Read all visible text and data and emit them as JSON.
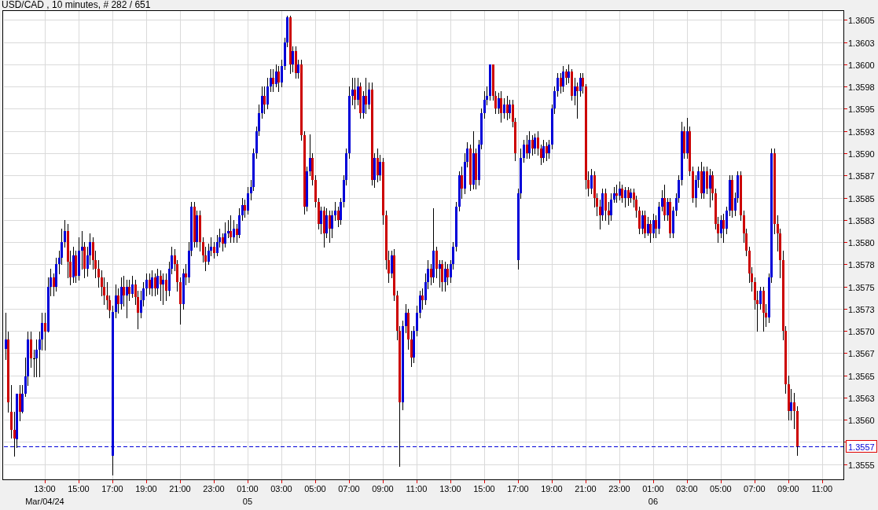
{
  "title": "USD/CAD , 10 minutes, # 282 / 651",
  "chart": {
    "chart_data": {
      "type": "candlestick",
      "grid": true,
      "ylim": [
        1.35532,
        1.36061
      ],
      "ref_lines": [
        {
          "axis": "y",
          "value": 1.3557,
          "label": "1.3557",
          "color": "#0000d8"
        }
      ],
      "categories": [
        null,
        null,
        null,
        null,
        null,
        null,
        null,
        null,
        null,
        null,
        null,
        null,
        null,
        null,
        "13:00\nMar/04/24",
        null,
        null,
        null,
        null,
        null,
        null,
        null,
        null,
        null,
        null,
        null,
        "15:00",
        null,
        null,
        null,
        null,
        null,
        null,
        null,
        null,
        null,
        null,
        null,
        "17:00",
        null,
        null,
        null,
        null,
        null,
        null,
        null,
        null,
        null,
        null,
        null,
        "19:00",
        null,
        null,
        null,
        null,
        null,
        null,
        null,
        null,
        null,
        null,
        null,
        "21:00",
        null,
        null,
        null,
        null,
        null,
        null,
        null,
        null,
        null,
        null,
        null,
        "23:00",
        null,
        null,
        null,
        null,
        null,
        null,
        null,
        null,
        null,
        null,
        null,
        "01:00\n05",
        null,
        null,
        null,
        null,
        null,
        null,
        null,
        null,
        null,
        null,
        null,
        "03:00",
        null,
        null,
        null,
        null,
        null,
        null,
        null,
        null,
        null,
        null,
        null,
        "05:00",
        null,
        null,
        null,
        null,
        null,
        null,
        null,
        null,
        null,
        null,
        null,
        "07:00",
        null,
        null,
        null,
        null,
        null,
        null,
        null,
        null,
        null,
        null,
        null,
        "09:00",
        null,
        null,
        null,
        null,
        null,
        null,
        null,
        null,
        null,
        null,
        null,
        "11:00",
        null,
        null,
        null,
        null,
        null,
        null,
        null,
        null,
        null,
        null,
        null,
        "13:00",
        null,
        null,
        null,
        null,
        null,
        null,
        null,
        null,
        null,
        null,
        null,
        "15:00",
        null,
        null,
        null,
        null,
        null,
        null,
        null,
        null,
        null,
        null,
        null,
        "17:00",
        null,
        null,
        null,
        null,
        null,
        null,
        null,
        null,
        null,
        null,
        null,
        "19:00",
        null,
        null,
        null,
        null,
        null,
        null,
        null,
        null,
        null,
        null,
        null,
        "21:00",
        null,
        null,
        null,
        null,
        null,
        null,
        null,
        null,
        null,
        null,
        null,
        "23:00",
        null,
        null,
        null,
        null,
        null,
        null,
        null,
        null,
        null,
        null,
        null,
        "01:00\n06",
        null,
        null,
        null,
        null,
        null,
        null,
        null,
        null,
        null,
        null,
        null,
        "03:00",
        null,
        null,
        null,
        null,
        null,
        null,
        null,
        null,
        null,
        null,
        null,
        "05:00",
        null,
        null,
        null,
        null,
        null,
        null,
        null,
        null,
        null,
        null,
        null,
        "07:00",
        null,
        null,
        null,
        null,
        null,
        null,
        null,
        null,
        null,
        null,
        null,
        "09:00",
        null,
        null,
        null,
        null,
        null,
        null,
        null,
        null,
        null,
        null,
        null,
        "11:00"
      ],
      "yticks": [
        {
          "value": 1.3605,
          "label": "1.3605"
        },
        {
          "value": 1.36025,
          "label": "1.3603"
        },
        {
          "value": 1.36,
          "label": "1.3600"
        },
        {
          "value": 1.35975,
          "label": "1.3598"
        },
        {
          "value": 1.3595,
          "label": "1.3595"
        },
        {
          "value": 1.35925,
          "label": "1.3593"
        },
        {
          "value": 1.359,
          "label": "1.3590"
        },
        {
          "value": 1.35875,
          "label": "1.3587"
        },
        {
          "value": 1.3585,
          "label": "1.3585"
        },
        {
          "value": 1.35825,
          "label": "1.3583"
        },
        {
          "value": 1.358,
          "label": "1.3580"
        },
        {
          "value": 1.35775,
          "label": "1.3578"
        },
        {
          "value": 1.3575,
          "label": "1.3575"
        },
        {
          "value": 1.35725,
          "label": "1.3573"
        },
        {
          "value": 1.357,
          "label": "1.3570"
        },
        {
          "value": 1.35675,
          "label": "1.3567"
        },
        {
          "value": 1.3565,
          "label": "1.3565"
        },
        {
          "value": 1.35625,
          "label": "1.3563"
        },
        {
          "value": 1.356,
          "label": "1.3560"
        },
        {
          "value": 1.3555,
          "label": "1.3555"
        }
      ],
      "ohlc": [
        [
          1.3568,
          1.3572,
          1.35668,
          1.3569
        ],
        [
          1.3569,
          1.35699,
          1.35609,
          1.3562
        ],
        [
          1.35609,
          1.35639,
          1.3558,
          1.35589
        ],
        [
          1.35589,
          1.35609,
          1.35559,
          1.35579
        ],
        [
          1.35578,
          1.35629,
          1.35569,
          1.35629
        ],
        [
          1.35629,
          1.35639,
          1.35599,
          1.35609
        ],
        [
          1.35609,
          1.35639,
          1.35608,
          1.35629
        ],
        [
          1.35629,
          1.3567,
          1.35627,
          1.35649
        ],
        [
          1.35649,
          1.35699,
          1.35639,
          1.3569
        ],
        [
          1.3569,
          1.35699,
          1.35659,
          1.35669
        ],
        [
          1.35669,
          1.35679,
          1.35649,
          1.35669
        ],
        [
          1.35669,
          1.3569,
          1.35649,
          1.35679
        ],
        [
          1.35679,
          1.35699,
          1.35649,
          1.3569
        ],
        [
          1.3569,
          1.3572,
          1.35679,
          1.35709
        ],
        [
          1.35709,
          1.3572,
          1.35679,
          1.35699
        ],
        [
          1.35699,
          1.3576,
          1.35699,
          1.3575
        ],
        [
          1.3575,
          1.3577,
          1.3574,
          1.3576
        ],
        [
          1.3576,
          1.35765,
          1.3574,
          1.3575
        ],
        [
          1.3575,
          1.35782,
          1.35745,
          1.35775
        ],
        [
          1.35775,
          1.3579,
          1.35765,
          1.35782
        ],
        [
          1.35782,
          1.35815,
          1.35775,
          1.358
        ],
        [
          1.358,
          1.35825,
          1.35795,
          1.35812
        ],
        [
          1.35812,
          1.3582,
          1.3576,
          1.35778
        ],
        [
          1.35778,
          1.3579,
          1.35752,
          1.3576
        ],
        [
          1.3576,
          1.35795,
          1.35755,
          1.35785
        ],
        [
          1.35785,
          1.3579,
          1.35755,
          1.35762
        ],
        [
          1.35762,
          1.35805,
          1.35758,
          1.3579
        ],
        [
          1.3579,
          1.35812,
          1.3577,
          1.35795
        ],
        [
          1.35795,
          1.358,
          1.3576,
          1.3577
        ],
        [
          1.3577,
          1.35795,
          1.35762,
          1.35785
        ],
        [
          1.35785,
          1.3581,
          1.35775,
          1.358
        ],
        [
          1.358,
          1.35805,
          1.3577,
          1.3578
        ],
        [
          1.3578,
          1.3579,
          1.3576,
          1.3577
        ],
        [
          1.3577,
          1.3578,
          1.3575,
          1.3576
        ],
        [
          1.3576,
          1.35768,
          1.3574,
          1.3575
        ],
        [
          1.3575,
          1.3576,
          1.3573,
          1.3574
        ],
        [
          1.3574,
          1.35755,
          1.35725,
          1.35735
        ],
        [
          1.35735,
          1.3574,
          1.35715,
          1.35723
        ],
        [
          1.35559,
          1.35728,
          1.35538,
          1.35721
        ],
        [
          1.35721,
          1.35752,
          1.35715,
          1.3574
        ],
        [
          1.3574,
          1.35748,
          1.3572,
          1.3573
        ],
        [
          1.3573,
          1.3576,
          1.35725,
          1.3575
        ],
        [
          1.3575,
          1.35762,
          1.35728,
          1.3574
        ],
        [
          1.3574,
          1.35758,
          1.35715,
          1.3575
        ],
        [
          1.3575,
          1.35758,
          1.35735,
          1.35742
        ],
        [
          1.35742,
          1.35762,
          1.35738,
          1.35752
        ],
        [
          1.35752,
          1.35758,
          1.3573,
          1.35738
        ],
        [
          1.35738,
          1.35745,
          1.35703,
          1.3572
        ],
        [
          1.3572,
          1.35745,
          1.35715,
          1.35735
        ],
        [
          1.35735,
          1.35755,
          1.35728,
          1.35748
        ],
        [
          1.35748,
          1.35765,
          1.3574,
          1.35758
        ],
        [
          1.35758,
          1.35765,
          1.35742,
          1.35748
        ],
        [
          1.35748,
          1.35768,
          1.3574,
          1.3576
        ],
        [
          1.3576,
          1.35765,
          1.3574,
          1.35748
        ],
        [
          1.35748,
          1.3577,
          1.35742,
          1.35762
        ],
        [
          1.35762,
          1.35768,
          1.35735,
          1.35752
        ],
        [
          1.35752,
          1.35765,
          1.3573,
          1.35758
        ],
        [
          1.35758,
          1.35765,
          1.35735,
          1.35745
        ],
        [
          1.35745,
          1.35778,
          1.3574,
          1.3577
        ],
        [
          1.3577,
          1.35795,
          1.35765,
          1.35785
        ],
        [
          1.35785,
          1.35792,
          1.35768,
          1.35775
        ],
        [
          1.35775,
          1.3578,
          1.35745,
          1.35755
        ],
        [
          1.35755,
          1.3576,
          1.35708,
          1.3573
        ],
        [
          1.3573,
          1.3577,
          1.35725,
          1.35765
        ],
        [
          1.35765,
          1.35775,
          1.35752,
          1.3576
        ],
        [
          1.3576,
          1.358,
          1.35755,
          1.3579
        ],
        [
          1.3579,
          1.35845,
          1.35785,
          1.3584
        ],
        [
          1.3584,
          1.35845,
          1.35795,
          1.358
        ],
        [
          1.358,
          1.35835,
          1.35795,
          1.3583
        ],
        [
          1.3583,
          1.35835,
          1.3579,
          1.358
        ],
        [
          1.358,
          1.35805,
          1.35778,
          1.35785
        ],
        [
          1.35785,
          1.35795,
          1.35768,
          1.35778
        ],
        [
          1.35778,
          1.35798,
          1.35775,
          1.3579
        ],
        [
          1.3579,
          1.35805,
          1.35785,
          1.35795
        ],
        [
          1.35795,
          1.358,
          1.35782,
          1.35788
        ],
        [
          1.35788,
          1.35808,
          1.35785,
          1.358
        ],
        [
          1.358,
          1.35815,
          1.35795,
          1.35805
        ],
        [
          1.35805,
          1.3581,
          1.3579,
          1.35798
        ],
        [
          1.35798,
          1.35822,
          1.35795,
          1.3581
        ],
        [
          1.3581,
          1.35825,
          1.35805,
          1.35812
        ],
        [
          1.35812,
          1.3583,
          1.358,
          1.35805
        ],
        [
          1.35805,
          1.35825,
          1.358,
          1.35815
        ],
        [
          1.35815,
          1.3582,
          1.358,
          1.35808
        ],
        [
          1.35808,
          1.35838,
          1.35805,
          1.3583
        ],
        [
          1.3583,
          1.3585,
          1.35825,
          1.35842
        ],
        [
          1.35842,
          1.35848,
          1.35828,
          1.35835
        ],
        [
          1.35835,
          1.35862,
          1.35832,
          1.35855
        ],
        [
          1.35855,
          1.3587,
          1.35848,
          1.35862
        ],
        [
          1.35862,
          1.35905,
          1.35858,
          1.359
        ],
        [
          1.359,
          1.3593,
          1.35895,
          1.35925
        ],
        [
          1.35925,
          1.35955,
          1.3592,
          1.35945
        ],
        [
          1.35945,
          1.35975,
          1.3594,
          1.35965
        ],
        [
          1.35965,
          1.35975,
          1.35945,
          1.35955
        ],
        [
          1.35955,
          1.35985,
          1.3595,
          1.35975
        ],
        [
          1.35975,
          1.35995,
          1.3597,
          1.35985
        ],
        [
          1.35985,
          1.35995,
          1.3597,
          1.35978
        ],
        [
          1.35978,
          1.36,
          1.35975,
          1.35992
        ],
        [
          1.35992,
          1.35998,
          1.3597,
          1.3598
        ],
        [
          1.3598,
          1.36005,
          1.35975,
          1.35998
        ],
        [
          1.35998,
          1.3603,
          1.35995,
          1.36025
        ],
        [
          1.36025,
          1.36055,
          1.3602,
          1.36053
        ],
        [
          1.36053,
          1.36055,
          1.3599,
          1.36
        ],
        [
          1.36,
          1.3602,
          1.35992,
          1.36015
        ],
        [
          1.36015,
          1.3602,
          1.35985,
          1.3599
        ],
        [
          1.3599,
          1.36005,
          1.35985,
          1.36
        ],
        [
          1.36,
          1.36005,
          1.35915,
          1.3592
        ],
        [
          1.3592,
          1.35925,
          1.35832,
          1.3584
        ],
        [
          1.3584,
          1.35885,
          1.35835,
          1.3588
        ],
        [
          1.3588,
          1.35921,
          1.35875,
          1.35895
        ],
        [
          1.35895,
          1.359,
          1.35865,
          1.3587
        ],
        [
          1.3587,
          1.35875,
          1.3584,
          1.35845
        ],
        [
          1.35845,
          1.3585,
          1.35815,
          1.3582
        ],
        [
          1.3582,
          1.3584,
          1.3581,
          1.35835
        ],
        [
          1.35835,
          1.3584,
          1.35795,
          1.3581
        ],
        [
          1.3581,
          1.35838,
          1.35805,
          1.3583
        ],
        [
          1.3583,
          1.35835,
          1.358,
          1.35815
        ],
        [
          1.35815,
          1.35835,
          1.35805,
          1.3583
        ],
        [
          1.3583,
          1.35845,
          1.35825,
          1.35835
        ],
        [
          1.35835,
          1.3584,
          1.35818,
          1.35825
        ],
        [
          1.35825,
          1.3585,
          1.3582,
          1.35845
        ],
        [
          1.35845,
          1.35875,
          1.3584,
          1.3587
        ],
        [
          1.3587,
          1.35905,
          1.35865,
          1.359
        ],
        [
          1.359,
          1.35975,
          1.35895,
          1.35965
        ],
        [
          1.35965,
          1.35985,
          1.35955,
          1.35972
        ],
        [
          1.35972,
          1.35985,
          1.3595,
          1.3596
        ],
        [
          1.3596,
          1.35985,
          1.35955,
          1.35975
        ],
        [
          1.35975,
          1.3598,
          1.3594,
          1.35945
        ],
        [
          1.35945,
          1.3597,
          1.3594,
          1.35965
        ],
        [
          1.35965,
          1.35985,
          1.35945,
          1.35955
        ],
        [
          1.35955,
          1.3598,
          1.3595,
          1.35972
        ],
        [
          1.35972,
          1.3598,
          1.35865,
          1.3587
        ],
        [
          1.3587,
          1.359,
          1.35862,
          1.35895
        ],
        [
          1.35895,
          1.35905,
          1.35868,
          1.35875
        ],
        [
          1.35875,
          1.35898,
          1.3587,
          1.3589
        ],
        [
          1.3589,
          1.35895,
          1.3582,
          1.3583
        ],
        [
          1.3583,
          1.35835,
          1.3577,
          1.3578
        ],
        [
          1.3578,
          1.3579,
          1.35755,
          1.35765
        ],
        [
          1.35765,
          1.3579,
          1.3576,
          1.35785
        ],
        [
          1.35785,
          1.35792,
          1.35735,
          1.3574
        ],
        [
          1.3574,
          1.35745,
          1.3569,
          1.357
        ],
        [
          1.357,
          1.35705,
          1.35548,
          1.3562
        ],
        [
          1.3562,
          1.35712,
          1.35612,
          1.35705
        ],
        [
          1.35705,
          1.3573,
          1.35698,
          1.3572
        ],
        [
          1.3572,
          1.35725,
          1.3568,
          1.3569
        ],
        [
          1.3569,
          1.357,
          1.3566,
          1.3567
        ],
        [
          1.3567,
          1.35705,
          1.35665,
          1.357
        ],
        [
          1.357,
          1.35728,
          1.35695,
          1.3572
        ],
        [
          1.3572,
          1.35745,
          1.35715,
          1.3574
        ],
        [
          1.3574,
          1.35748,
          1.35725,
          1.35735
        ],
        [
          1.35735,
          1.35765,
          1.3573,
          1.35755
        ],
        [
          1.35755,
          1.3578,
          1.35748,
          1.3577
        ],
        [
          1.3577,
          1.35775,
          1.35752,
          1.3576
        ],
        [
          1.3576,
          1.35838,
          1.35755,
          1.3579
        ],
        [
          1.3579,
          1.35795,
          1.3576,
          1.3577
        ],
        [
          1.3577,
          1.3578,
          1.3575,
          1.35775
        ],
        [
          1.35775,
          1.3578,
          1.35745,
          1.35755
        ],
        [
          1.35755,
          1.35778,
          1.35745,
          1.3577
        ],
        [
          1.3577,
          1.35775,
          1.35752,
          1.3576
        ],
        [
          1.3576,
          1.3578,
          1.35755,
          1.35775
        ],
        [
          1.35775,
          1.358,
          1.3577,
          1.35795
        ],
        [
          1.35795,
          1.35845,
          1.3579,
          1.3584
        ],
        [
          1.3584,
          1.3588,
          1.35835,
          1.35875
        ],
        [
          1.35875,
          1.35885,
          1.3585,
          1.3586
        ],
        [
          1.3586,
          1.359,
          1.35855,
          1.3589
        ],
        [
          1.3589,
          1.35912,
          1.35885,
          1.35905
        ],
        [
          1.35905,
          1.3591,
          1.35858,
          1.35865
        ],
        [
          1.35865,
          1.35925,
          1.3586,
          1.359
        ],
        [
          1.359,
          1.35905,
          1.3586,
          1.3587
        ],
        [
          1.3587,
          1.35915,
          1.35865,
          1.3591
        ],
        [
          1.3591,
          1.3595,
          1.35905,
          1.35945
        ],
        [
          1.35945,
          1.3597,
          1.3594,
          1.3596
        ],
        [
          1.3596,
          1.35975,
          1.35955,
          1.35965
        ],
        [
          1.35965,
          1.36,
          1.3596,
          1.36
        ],
        [
          1.36,
          1.36,
          1.3596,
          1.35965
        ],
        [
          1.35965,
          1.3597,
          1.35945,
          1.3595
        ],
        [
          1.3595,
          1.35968,
          1.35945,
          1.35962
        ],
        [
          1.35962,
          1.3597,
          1.35935,
          1.35945
        ],
        [
          1.35945,
          1.35962,
          1.3594,
          1.35955
        ],
        [
          1.35955,
          1.35965,
          1.35938,
          1.35945
        ],
        [
          1.35945,
          1.3596,
          1.3594,
          1.35955
        ],
        [
          1.35955,
          1.3596,
          1.3593,
          1.35935
        ],
        [
          1.35935,
          1.3594,
          1.35892,
          1.359
        ],
        [
          1.3578,
          1.3586,
          1.3577,
          1.35855
        ],
        [
          1.35855,
          1.35905,
          1.3585,
          1.35895
        ],
        [
          1.35895,
          1.35915,
          1.3589,
          1.3591
        ],
        [
          1.3591,
          1.3592,
          1.35895,
          1.359
        ],
        [
          1.359,
          1.35925,
          1.35895,
          1.35915
        ],
        [
          1.35915,
          1.3592,
          1.35898,
          1.35905
        ],
        [
          1.35905,
          1.35922,
          1.359,
          1.35918
        ],
        [
          1.35918,
          1.35925,
          1.35898,
          1.35905
        ],
        [
          1.35905,
          1.3591,
          1.35888,
          1.35895
        ],
        [
          1.35895,
          1.35915,
          1.3589,
          1.35908
        ],
        [
          1.35908,
          1.35912,
          1.35892,
          1.359
        ],
        [
          1.359,
          1.35915,
          1.35895,
          1.3591
        ],
        [
          1.3591,
          1.35955,
          1.35905,
          1.3595
        ],
        [
          1.3595,
          1.35975,
          1.35945,
          1.3597
        ],
        [
          1.3597,
          1.3599,
          1.35965,
          1.35985
        ],
        [
          1.35985,
          1.3599,
          1.35968,
          1.35975
        ],
        [
          1.35975,
          1.35998,
          1.3597,
          1.35992
        ],
        [
          1.35992,
          1.35995,
          1.35978,
          1.35985
        ],
        [
          1.35985,
          1.36,
          1.3598,
          1.35992
        ],
        [
          1.35992,
          1.35995,
          1.3596,
          1.35965
        ],
        [
          1.35965,
          1.35985,
          1.35955,
          1.35975
        ],
        [
          1.35975,
          1.3598,
          1.3594,
          1.3597
        ],
        [
          1.3597,
          1.3599,
          1.35965,
          1.35985
        ],
        [
          1.35985,
          1.3599,
          1.35968,
          1.35975
        ],
        [
          1.35975,
          1.35978,
          1.3586,
          1.3587
        ],
        [
          1.3587,
          1.3588,
          1.35852,
          1.3586
        ],
        [
          1.3586,
          1.35882,
          1.35855,
          1.35875
        ],
        [
          1.35875,
          1.3588,
          1.3584,
          1.3585
        ],
        [
          1.3585,
          1.35855,
          1.3583,
          1.3584
        ],
        [
          1.3584,
          1.35848,
          1.35815,
          1.3583
        ],
        [
          1.3583,
          1.3586,
          1.35825,
          1.35855
        ],
        [
          1.35855,
          1.3586,
          1.35825,
          1.35835
        ],
        [
          1.35835,
          1.35845,
          1.3582,
          1.3583
        ],
        [
          1.3583,
          1.35855,
          1.35825,
          1.35848
        ],
        [
          1.35848,
          1.35862,
          1.35845,
          1.35855
        ],
        [
          1.35855,
          1.35865,
          1.35845,
          1.35852
        ],
        [
          1.35852,
          1.35868,
          1.35848,
          1.3586
        ],
        [
          1.3586,
          1.35865,
          1.35845,
          1.3585
        ],
        [
          1.3585,
          1.35862,
          1.3584,
          1.35858
        ],
        [
          1.35858,
          1.35862,
          1.35842,
          1.3585
        ],
        [
          1.3585,
          1.3586,
          1.35845,
          1.35856
        ],
        [
          1.35856,
          1.3586,
          1.3584,
          1.35848
        ],
        [
          1.35848,
          1.35852,
          1.35828,
          1.35835
        ],
        [
          1.35835,
          1.3584,
          1.3581,
          1.35815
        ],
        [
          1.35815,
          1.35835,
          1.3581,
          1.3583
        ],
        [
          1.3583,
          1.35835,
          1.35805,
          1.3581
        ],
        [
          1.3581,
          1.35828,
          1.35808,
          1.3582
        ],
        [
          1.3582,
          1.35825,
          1.358,
          1.3581
        ],
        [
          1.3581,
          1.35832,
          1.35805,
          1.35825
        ],
        [
          1.35825,
          1.3583,
          1.35805,
          1.35815
        ],
        [
          1.35815,
          1.35845,
          1.3581,
          1.3584
        ],
        [
          1.3584,
          1.35858,
          1.35835,
          1.3585
        ],
        [
          1.3585,
          1.35865,
          1.35825,
          1.3583
        ],
        [
          1.3583,
          1.3585,
          1.35825,
          1.35845
        ],
        [
          1.35845,
          1.3585,
          1.35805,
          1.3581
        ],
        [
          1.3581,
          1.3584,
          1.35805,
          1.35835
        ],
        [
          1.35835,
          1.35855,
          1.3583,
          1.3585
        ],
        [
          1.3585,
          1.35875,
          1.35845,
          1.3587
        ],
        [
          1.3587,
          1.35935,
          1.35865,
          1.35925
        ],
        [
          1.35925,
          1.3593,
          1.35895,
          1.359
        ],
        [
          1.359,
          1.3594,
          1.35895,
          1.35925
        ],
        [
          1.35925,
          1.3593,
          1.35875,
          1.3588
        ],
        [
          1.3588,
          1.35885,
          1.35845,
          1.3585
        ],
        [
          1.3585,
          1.35875,
          1.3584,
          1.3587
        ],
        [
          1.3587,
          1.35885,
          1.35862,
          1.3588
        ],
        [
          1.3588,
          1.3589,
          1.3585,
          1.35855
        ],
        [
          1.35855,
          1.35885,
          1.3585,
          1.3588
        ],
        [
          1.3588,
          1.35885,
          1.35855,
          1.3586
        ],
        [
          1.3586,
          1.35882,
          1.3584,
          1.35875
        ],
        [
          1.35875,
          1.3588,
          1.35848,
          1.35855
        ],
        [
          1.35855,
          1.3586,
          1.35815,
          1.3582
        ],
        [
          1.3582,
          1.35828,
          1.358,
          1.3581
        ],
        [
          1.3581,
          1.3583,
          1.35805,
          1.35825
        ],
        [
          1.35825,
          1.35832,
          1.358,
          1.35815
        ],
        [
          1.35815,
          1.3584,
          1.3581,
          1.35835
        ],
        [
          1.35835,
          1.35875,
          1.3583,
          1.3587
        ],
        [
          1.3587,
          1.35875,
          1.35828,
          1.35835
        ],
        [
          1.35835,
          1.35856,
          1.3583,
          1.3585
        ],
        [
          1.3585,
          1.3588,
          1.35845,
          1.35875
        ],
        [
          1.35875,
          1.3588,
          1.35825,
          1.3583
        ],
        [
          1.3583,
          1.35835,
          1.358,
          1.3581
        ],
        [
          1.3581,
          1.35815,
          1.35785,
          1.3579
        ],
        [
          1.3579,
          1.35795,
          1.35755,
          1.35765
        ],
        [
          1.35765,
          1.35772,
          1.35745,
          1.35755
        ],
        [
          1.35755,
          1.3576,
          1.35725,
          1.35735
        ],
        [
          1.35735,
          1.35745,
          1.357,
          1.3573
        ],
        [
          1.3573,
          1.3575,
          1.35725,
          1.35745
        ],
        [
          1.35745,
          1.3575,
          1.357,
          1.3572
        ],
        [
          1.3572,
          1.3573,
          1.35705,
          1.35715
        ],
        [
          1.35715,
          1.35765,
          1.3571,
          1.3576
        ],
        [
          1.3576,
          1.35905,
          1.35755,
          1.359
        ],
        [
          1.359,
          1.35905,
          1.3581,
          1.3582
        ],
        [
          1.3582,
          1.3583,
          1.3579,
          1.3581
        ],
        [
          1.3581,
          1.35815,
          1.3576,
          1.3578
        ],
        [
          1.3578,
          1.3579,
          1.3569,
          1.357
        ],
        [
          1.357,
          1.35705,
          1.3563,
          1.3564
        ],
        [
          1.3564,
          1.3565,
          1.356,
          1.3561
        ],
        [
          1.3561,
          1.35635,
          1.356,
          1.3562
        ],
        [
          1.3562,
          1.3563,
          1.3559,
          1.3561
        ],
        [
          1.3561,
          1.35615,
          1.3556,
          1.3557
        ],
        null,
        null,
        null,
        null,
        null,
        null,
        null,
        null,
        null
      ]
    }
  }
}
